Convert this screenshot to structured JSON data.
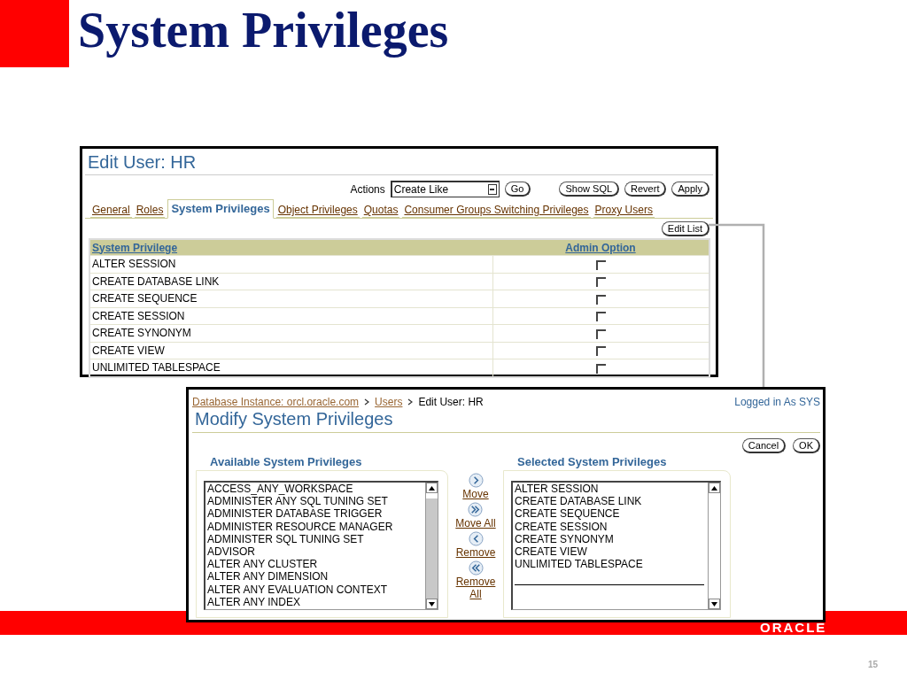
{
  "slide": {
    "title": "System Privileges",
    "logo": "ORACLE",
    "page_number": "15"
  },
  "edit_user": {
    "title": "Edit User: HR",
    "actions_label": "Actions",
    "actions_value": "Create Like",
    "go": "Go",
    "buttons": [
      "Show SQL",
      "Revert",
      "Apply"
    ],
    "tabs": [
      {
        "label": "General",
        "selected": false
      },
      {
        "label": "Roles",
        "selected": false
      },
      {
        "label": "System Privileges",
        "selected": true
      },
      {
        "label": "Object Privileges",
        "selected": false
      },
      {
        "label": "Quotas",
        "selected": false
      },
      {
        "label": "Consumer Groups Switching Privileges",
        "selected": false
      },
      {
        "label": "Proxy Users",
        "selected": false
      }
    ],
    "edit_list": "Edit List",
    "columns": [
      "System Privilege",
      "Admin Option"
    ],
    "rows": [
      {
        "privilege": "ALTER SESSION",
        "admin_option": false
      },
      {
        "privilege": "CREATE DATABASE LINK",
        "admin_option": false
      },
      {
        "privilege": "CREATE SEQUENCE",
        "admin_option": false
      },
      {
        "privilege": "CREATE SESSION",
        "admin_option": false
      },
      {
        "privilege": "CREATE SYNONYM",
        "admin_option": false
      },
      {
        "privilege": "CREATE VIEW",
        "admin_option": false
      },
      {
        "privilege": "UNLIMITED TABLESPACE",
        "admin_option": false
      }
    ]
  },
  "modify": {
    "breadcrumb": [
      {
        "label": "Database Instance: orcl.oracle.com",
        "link": true
      },
      {
        "label": "Users",
        "link": true
      },
      {
        "label": "Edit User: HR",
        "link": false
      }
    ],
    "logged_in": "Logged in As SYS",
    "title": "Modify System Privileges",
    "buttons": [
      "Cancel",
      "OK"
    ],
    "available": {
      "heading": "Available System Privileges",
      "items": [
        "ACCESS_ANY_WORKSPACE",
        "ADMINISTER ANY SQL TUNING SET",
        "ADMINISTER DATABASE TRIGGER",
        "ADMINISTER RESOURCE MANAGER",
        "ADMINISTER SQL TUNING SET",
        "ADVISOR",
        "ALTER ANY CLUSTER",
        "ALTER ANY DIMENSION",
        "ALTER ANY EVALUATION CONTEXT",
        "ALTER ANY INDEX"
      ]
    },
    "shuttle": [
      {
        "kind": "move",
        "label": "Move"
      },
      {
        "kind": "move_all",
        "label": "Move All"
      },
      {
        "kind": "remove",
        "label": "Remove"
      },
      {
        "kind": "remove_all",
        "label": "Remove All"
      }
    ],
    "selected": {
      "heading": "Selected System Privileges",
      "items": [
        "ALTER SESSION",
        "CREATE DATABASE LINK",
        "CREATE SEQUENCE",
        "CREATE SESSION",
        "CREATE SYNONYM",
        "CREATE VIEW",
        "UNLIMITED TABLESPACE"
      ]
    }
  }
}
